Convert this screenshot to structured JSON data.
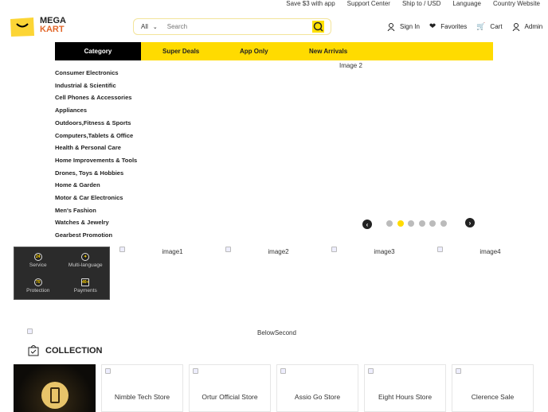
{
  "top_links": [
    "Save $3 with app",
    "Support Center",
    "Ship to / USD",
    "Language",
    "Country Website"
  ],
  "logo": {
    "line1": "MEGA",
    "line2": "KART"
  },
  "search": {
    "scope": "All",
    "placeholder": "Search"
  },
  "actions": [
    "Sign In",
    "Favorites",
    "Cart",
    "Admin"
  ],
  "nav": {
    "category": "Category",
    "items": [
      "Super Deals",
      "App Only",
      "New Arrivals"
    ]
  },
  "categories": [
    "Consumer Electronics",
    "Industrial & Scientific",
    "Cell Phones & Accessories",
    "Appliances",
    "Outdoors,Fitness & Sports",
    "Computers,Tablets & Office",
    "Health & Personal Care",
    "Home Improvements & Tools",
    "Drones, Toys & Hobbies",
    "Home & Garden",
    "Motor & Car Electronics",
    "Men's Fashion",
    "Watches & Jewelry",
    "Gearbest Promotion"
  ],
  "banner": {
    "alt": "Image 2",
    "slides": 6,
    "active_slide": 2
  },
  "features": [
    {
      "label": "Service",
      "badge": "24"
    },
    {
      "label": "Multi-language",
      "badge": "✦"
    },
    {
      "label": "Protection",
      "badge": "70"
    },
    {
      "label": "Payments",
      "badge": "40+"
    }
  ],
  "promo_images": [
    "image1",
    "image2",
    "image3",
    "image4"
  ],
  "below_second": "BelowSecond",
  "collection": {
    "title": "COLLECTION",
    "stores": [
      "Nimble Tech Store",
      "Ortur Official Store",
      "Assio Go Store",
      "Eight Hours Store",
      "Clerence Sale"
    ]
  },
  "colors": {
    "accent": "#ffdb00",
    "logo_orange": "#e2672a"
  }
}
